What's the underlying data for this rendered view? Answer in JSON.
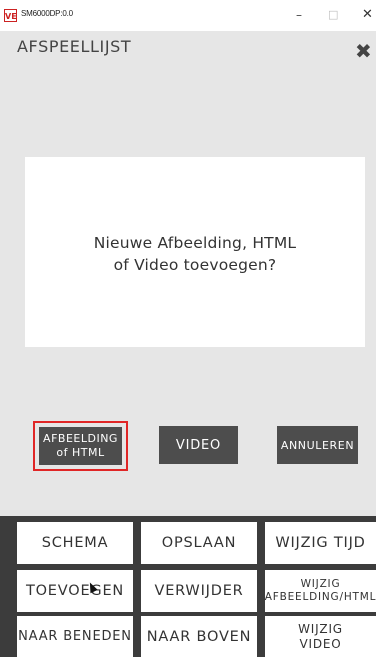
{
  "window": {
    "app_icon_text": "VE",
    "title": "SM6000DP:0.0",
    "min_symbol": "–",
    "max_symbol": "□",
    "close_symbol": "✕"
  },
  "page": {
    "title": "AFSPEELLIJST",
    "close_symbol": "✖"
  },
  "dialog": {
    "line1": "Nieuwe Afbeelding, HTML",
    "line2": "of Video toevoegen?"
  },
  "actions": {
    "image_line1": "AFBEELDING",
    "image_line2": "of HTML",
    "video": "VIDEO",
    "cancel": "ANNULEREN"
  },
  "menu": {
    "schema": "SCHEMA",
    "opslaan": "OPSLAAN",
    "wijzig_tijd": "WIJZIG TIJD",
    "toevoegen": "TOEVOEGEN",
    "verwijder": "VERWIJDER",
    "wijzig_afb_line1": "WIJZIG",
    "wijzig_afb_line2": "AFBEELDING/HTML",
    "naar_beneden": "NAAR BENEDEN",
    "naar_boven": "NAAR BOVEN",
    "wijzig_video_line1": "WIJZIG",
    "wijzig_video_line2": "VIDEO"
  },
  "colors": {
    "background": "#e6e6e6",
    "dark_button": "#4d4d4d",
    "focus_border": "#e02626",
    "panel": "#3c3c3c"
  }
}
